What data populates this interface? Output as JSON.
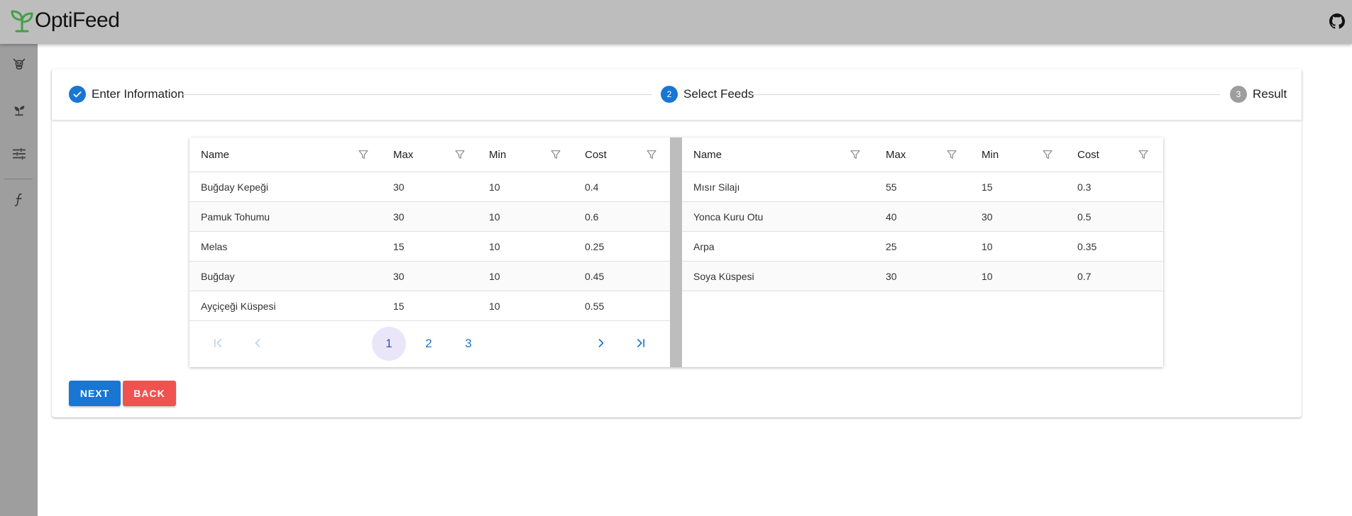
{
  "app": {
    "name": "OptiFeed",
    "logo_icon": "sprout-icon",
    "github_icon": "github-icon"
  },
  "colors": {
    "primary": "#1976d2",
    "danger": "#ef5350",
    "topbar": "#bdbdbd",
    "sidebar": "#9e9e9e",
    "logo_green": "#4caf50"
  },
  "sidebar": {
    "items": [
      {
        "icon": "cow-icon"
      },
      {
        "icon": "plant-icon"
      },
      {
        "icon": "sliders-icon"
      },
      {
        "icon": "function-icon"
      }
    ]
  },
  "stepper": {
    "steps": [
      {
        "label": "Enter Information",
        "state": "completed",
        "number": "1"
      },
      {
        "label": "Select Feeds",
        "state": "active",
        "number": "2"
      },
      {
        "label": "Result",
        "state": "pending",
        "number": "3"
      }
    ]
  },
  "left_table": {
    "columns": [
      "Name",
      "Max",
      "Min",
      "Cost"
    ],
    "rows": [
      [
        "Buğday Kepeği",
        "30",
        "10",
        "0.4"
      ],
      [
        "Pamuk Tohumu",
        "30",
        "10",
        "0.6"
      ],
      [
        "Melas",
        "15",
        "10",
        "0.25"
      ],
      [
        "Buğday",
        "30",
        "10",
        "0.45"
      ],
      [
        "Ayçiçeği Küspesi",
        "15",
        "10",
        "0.55"
      ]
    ],
    "pagination": {
      "pages": [
        "1",
        "2",
        "3"
      ],
      "current": "1"
    }
  },
  "right_table": {
    "columns": [
      "Name",
      "Max",
      "Min",
      "Cost"
    ],
    "rows": [
      [
        "Mısır Silajı",
        "55",
        "15",
        "0.3"
      ],
      [
        "Yonca Kuru Otu",
        "40",
        "30",
        "0.5"
      ],
      [
        "Arpa",
        "25",
        "10",
        "0.35"
      ],
      [
        "Soya Küspesi",
        "30",
        "10",
        "0.7"
      ]
    ]
  },
  "actions": {
    "next_label": "NEXT",
    "back_label": "BACK"
  }
}
